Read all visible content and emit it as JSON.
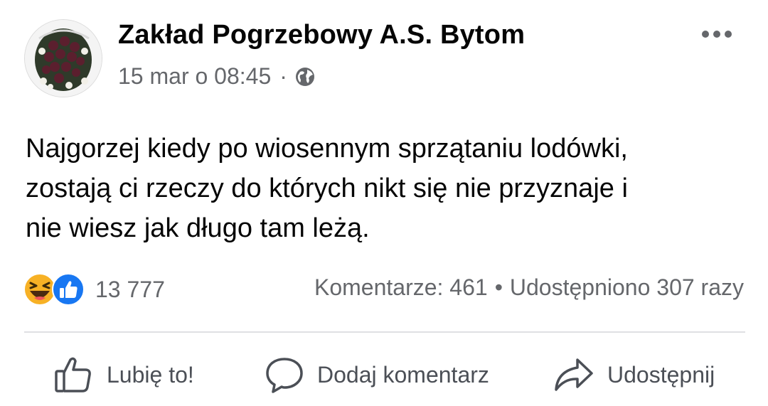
{
  "post": {
    "author": "Zakład Pogrzebowy A.S. Bytom",
    "timestamp": "15 mar o 08:45",
    "separator": "·",
    "audience_icon": "globe-icon",
    "more_icon": "more-dots-icon",
    "text_lines": [
      "Najgorzej kiedy po wiosennym sprzątaniu lodówki,",
      "zostają ci rzeczy do których nikt się nie przyznaje i",
      "nie wiesz jak długo tam leżą."
    ]
  },
  "reactions": {
    "icons": [
      "haha-reaction-icon",
      "like-reaction-icon"
    ],
    "count": "13 777"
  },
  "stats": {
    "comments": "Komentarze: 461",
    "bullet": "•",
    "shares": "Udostępniono 307 razy"
  },
  "actions": {
    "like_label": "Lubię to!",
    "comment_label": "Dodaj komentarz",
    "share_label": "Udostępnij"
  },
  "colors": {
    "text": "#050505",
    "secondary_text": "#65676b",
    "action_text": "#4b4f56",
    "like_blue": "#1877f2",
    "haha_yellow": "#f7b125",
    "divider": "#dfe0e3"
  }
}
